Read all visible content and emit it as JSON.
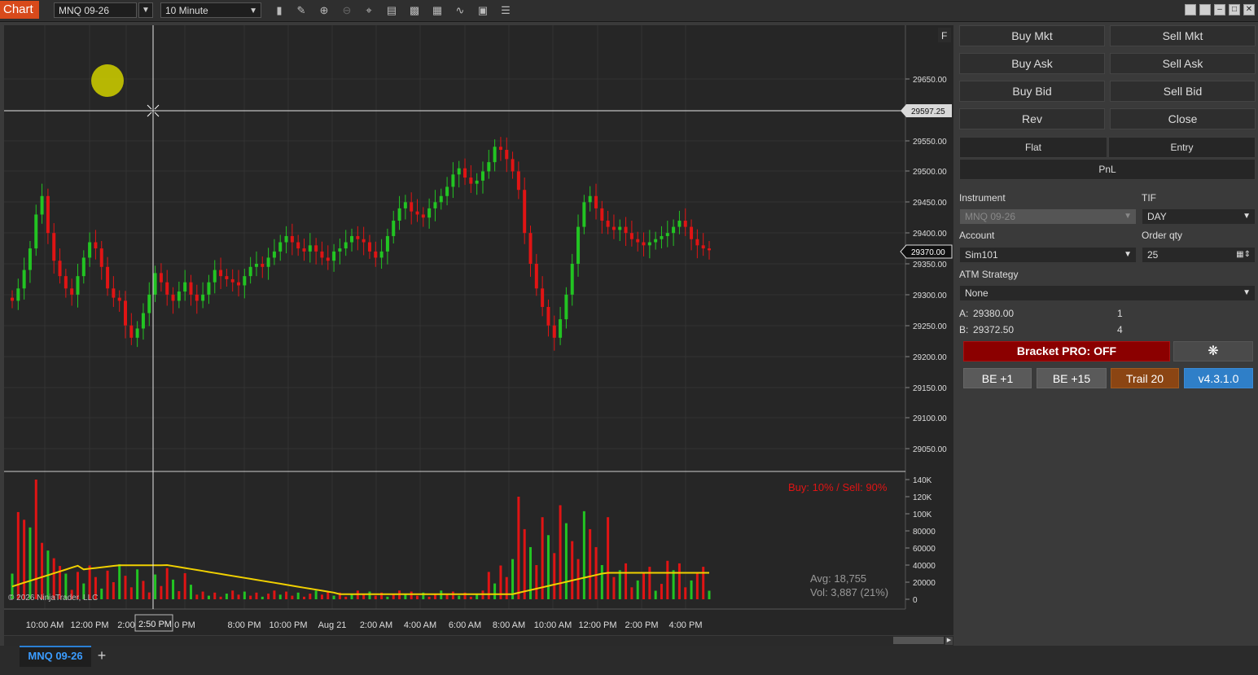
{
  "toolbar": {
    "chart_tab": "Chart",
    "instrument": "MNQ 09-26",
    "timeframe": "10 Minute",
    "icons": [
      "bar-type-icon",
      "drawing-tools-icon",
      "zoom-in-icon",
      "zoom-out-icon",
      "crosshair-icon",
      "data-box-icon",
      "templates-icon",
      "strategies-icon",
      "indicators-icon",
      "properties-icon",
      "order-panel-icon"
    ]
  },
  "chart": {
    "price_ticks": [
      "29650.00",
      "29550.00",
      "29500.00",
      "29450.00",
      "29400.00",
      "29350.00",
      "29300.00",
      "29250.00",
      "29200.00",
      "29150.00",
      "29100.00",
      "29050.00"
    ],
    "crosshair_price": "29597.25",
    "last_price": "29370.00",
    "f_label": "F",
    "volume_ticks": [
      "140K",
      "120K",
      "100K",
      "80000",
      "60000",
      "40000",
      "20000",
      "0"
    ],
    "time_ticks": [
      "10:00 AM",
      "12:00 PM",
      "2:00",
      "0 PM",
      "8:00 PM",
      "10:00 PM",
      "Aug 21",
      "2:00 AM",
      "4:00 AM",
      "6:00 AM",
      "8:00 AM",
      "10:00 AM",
      "12:00 PM",
      "2:00 PM",
      "4:00 PM"
    ],
    "crosshair_time": "2:50 PM",
    "buy_sell_label": "Buy: 10% / Sell: 90%",
    "avg_label": "Avg: 18,755",
    "vol_label": "Vol: 3,887 (21%)",
    "copyright": "© 2026 NinjaTrader, LLC",
    "colors": {
      "up": "#22c422",
      "down": "#e01414",
      "vol_ma": "#f0d000",
      "bg": "#262626"
    }
  },
  "chart_data": {
    "type": "candlestick",
    "y_range": [
      29000,
      29700
    ],
    "closes": [
      29290,
      29310,
      29340,
      29375,
      29430,
      29460,
      29400,
      29355,
      29330,
      29310,
      29300,
      29330,
      29360,
      29385,
      29375,
      29345,
      29310,
      29295,
      29290,
      29250,
      29230,
      29245,
      29270,
      29300,
      29335,
      29320,
      29300,
      29290,
      29305,
      29320,
      29300,
      29290,
      29300,
      29320,
      29340,
      29330,
      29325,
      29320,
      29315,
      29330,
      29345,
      29350,
      29345,
      29360,
      29370,
      29385,
      29395,
      29385,
      29375,
      29370,
      29380,
      29370,
      29360,
      29355,
      29370,
      29375,
      29385,
      29395,
      29390,
      29385,
      29370,
      29360,
      29370,
      29395,
      29420,
      29440,
      29450,
      29435,
      29430,
      29425,
      29440,
      29450,
      29460,
      29475,
      29495,
      29505,
      29490,
      29480,
      29485,
      29500,
      29515,
      29540,
      29535,
      29520,
      29500,
      29470,
      29400,
      29350,
      29310,
      29280,
      29250,
      29230,
      29260,
      29300,
      29350,
      29410,
      29450,
      29460,
      29440,
      29420,
      29410,
      29405,
      29410,
      29400,
      29390,
      29385,
      29380,
      29385,
      29390,
      29395,
      29400,
      29410,
      29420,
      29410,
      29390,
      29380,
      29375,
      29372
    ],
    "volume_ma_max": 40000,
    "volume_range": [
      0,
      140000
    ]
  },
  "tabs": {
    "instrument_tab": "MNQ 09-26",
    "add": "+"
  },
  "panel": {
    "buy_mkt": "Buy Mkt",
    "sell_mkt": "Sell Mkt",
    "buy_ask": "Buy Ask",
    "sell_ask": "Sell Ask",
    "buy_bid": "Buy Bid",
    "sell_bid": "Sell Bid",
    "rev": "Rev",
    "close": "Close",
    "flat": "Flat",
    "entry": "Entry",
    "pnl": "PnL",
    "instrument_label": "Instrument",
    "instrument_value": "MNQ 09-26",
    "tif_label": "TIF",
    "tif_value": "DAY",
    "account_label": "Account",
    "account_value": "Sim101",
    "qty_label": "Order qty",
    "qty_value": "25",
    "atm_label": "ATM Strategy",
    "atm_value": "None",
    "ask_label": "A:",
    "ask_price": "29380.00",
    "ask_size": "1",
    "bid_label": "B:",
    "bid_price": "29372.50",
    "bid_size": "4",
    "bracket": "Bracket PRO: OFF",
    "be1": "BE +1",
    "be15": "BE +15",
    "trail": "Trail 20",
    "version": "v4.3.1.0"
  }
}
